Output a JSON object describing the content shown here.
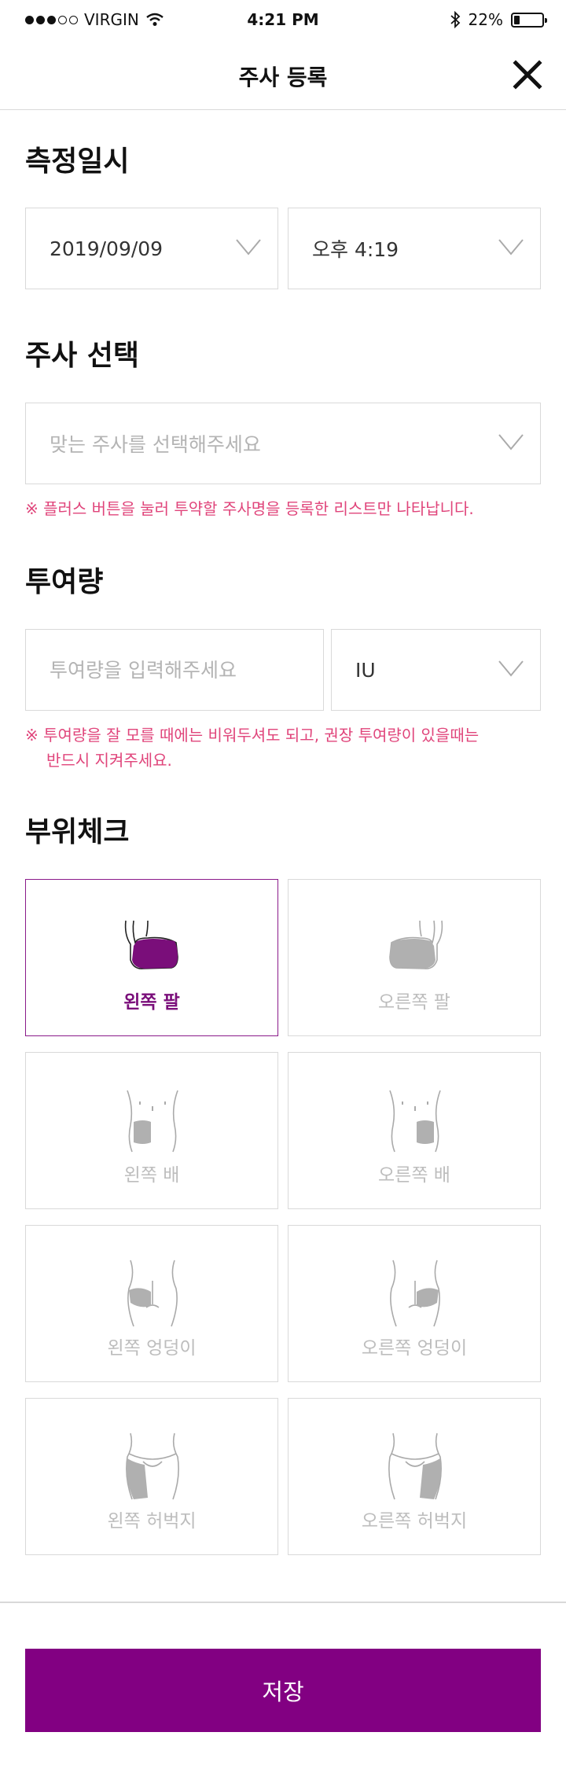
{
  "status_bar": {
    "carrier": "VIRGIN",
    "time": "4:21 PM",
    "battery": "22%",
    "battery_level": 0.22
  },
  "nav": {
    "title": "주사 등록"
  },
  "measure_date": {
    "title": "측정일시",
    "date": "2019/09/09",
    "time": "오후 4:19"
  },
  "injection_select": {
    "title": "주사 선택",
    "placeholder": "맞는 주사를 선택해주세요",
    "note": "※ 플러스 버튼을 눌러 투약할 주사명을 등록한 리스트만 나타납니다."
  },
  "dosage": {
    "title": "투여량",
    "placeholder": "투여량을 입력해주세요",
    "unit": "IU",
    "note_line1": "※ 투여량을 잘 모를 때에는 비워두셔도 되고, 권장 투여량이 있을때는",
    "note_line2": "반드시 지켜주세요."
  },
  "site_check": {
    "title": "부위체크",
    "sites": [
      {
        "label": "왼쪽 팔",
        "icon": "left-arm-icon",
        "selected": true
      },
      {
        "label": "오른쪽 팔",
        "icon": "right-arm-icon",
        "selected": false
      },
      {
        "label": "왼쪽 배",
        "icon": "left-belly-icon",
        "selected": false
      },
      {
        "label": "오른쪽 배",
        "icon": "right-belly-icon",
        "selected": false
      },
      {
        "label": "왼쪽 엉덩이",
        "icon": "left-buttock-icon",
        "selected": false
      },
      {
        "label": "오른쪽 엉덩이",
        "icon": "right-buttock-icon",
        "selected": false
      },
      {
        "label": "왼쪽 허벅지",
        "icon": "left-thigh-icon",
        "selected": false
      },
      {
        "label": "오른쪽 허벅지",
        "icon": "right-thigh-icon",
        "selected": false
      }
    ]
  },
  "save_label": "저장",
  "colors": {
    "accent": "#820082",
    "selected_fill": "#7a0e7a",
    "note": "#e0457b",
    "inactive_fill": "#b0b0b0",
    "border": "#d9d9d9"
  }
}
